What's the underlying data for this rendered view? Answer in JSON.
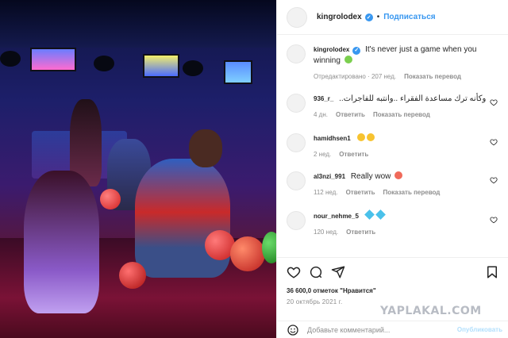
{
  "post": {
    "author": "kingrolodex",
    "follow_label": "Подписаться",
    "dot": "•"
  },
  "caption": {
    "user": "kingrolodex",
    "text": "It's never just a game when you winning",
    "edited": "Отредактировано",
    "time": "207 нед.",
    "translate": "Показать перевод"
  },
  "comments": [
    {
      "user": "936_r_",
      "text": "وكأنه ترك مساعدة الفقراء ..وانتبه للفاجرات..",
      "time": "4 дн.",
      "reply": "Ответить",
      "translate": "Показать перевод"
    },
    {
      "user": "hamidhsen1",
      "text": "",
      "time": "2 нед.",
      "reply": "Ответить"
    },
    {
      "user": "al3nzi_991",
      "text": "Really wow",
      "time": "112 нед.",
      "reply": "Ответить",
      "translate": "Показать перевод"
    },
    {
      "user": "nour_nehme_5",
      "text": "",
      "time": "120 нед.",
      "reply": "Ответить"
    }
  ],
  "likes": "36 600,0 отметок \"Нравится\"",
  "date": "20 октябрь 2021 г.",
  "comment_box": {
    "placeholder": "Добавьте комментарий...",
    "publish": "Опубликовать"
  },
  "watermark": "YAPLAKAL.COM",
  "colors": {
    "link": "#3897f0",
    "meta": "#8e8e8e",
    "publish_disabled": "#b2dffc"
  },
  "icons": [
    "verified-icon",
    "heart-icon",
    "comment-icon",
    "share-icon",
    "bookmark-icon",
    "smile-icon"
  ]
}
